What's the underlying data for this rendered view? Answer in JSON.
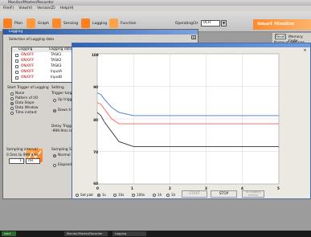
{
  "app": {
    "title": "Monitor/Master/Recorder"
  },
  "menu": [
    "File(F)",
    "View(V)",
    "Version(Z)",
    "Help(H)"
  ],
  "toolbar": {
    "buttons": [
      {
        "label": "Plan",
        "color": "#ff7f1f"
      },
      {
        "label": "Graph",
        "color": "#ff7f1f"
      },
      {
        "label": "Sensing",
        "color": "#ff7f1f"
      },
      {
        "label": "Logging",
        "color": "#ff7f1f"
      },
      {
        "label": "Function",
        "color": "#ff7f1f"
      }
    ],
    "operating_label": "OperatingCH",
    "operating_value": "0CH",
    "brand": "Smart Monitor"
  },
  "logging": {
    "title": "Logging",
    "group_selection": "Selection of Logging data",
    "headers": [
      "Logging",
      "Logging data",
      "Mul",
      "Multipli"
    ],
    "rows": [
      {
        "state": "ON/OFF",
        "data": "TASK1"
      },
      {
        "state": "ON/OFF",
        "data": "TASK2"
      },
      {
        "state": "ON/OFF",
        "data": "TASK3"
      },
      {
        "state": "ON/OFF",
        "data": "InputA"
      },
      {
        "state": "ON/OFF",
        "data": "InputB"
      }
    ],
    "trigger_group": "Start Trigger of Logging",
    "trigger_options": [
      "None",
      "Pattern of I/O",
      "Data Slope",
      "Data Window",
      "Time instant"
    ],
    "trigger_selected": 2,
    "setting_label": "Setting",
    "trigger_target": "Trigger target",
    "up_trigger": "Up trigger",
    "down_trigger": "Down trig",
    "delay_trigger": "Delay Trigger",
    "delay_value": "-999.9ms to 99",
    "sampling_interval": "Sampling interval",
    "sampling_range": "0.5ms to 999.9ms",
    "sampling_value": "1",
    "sampling_unit": "ms",
    "sampling_stop": "Sampling Stop",
    "normal_lo": "Normal lo",
    "elapsed_ti": "Elapsed ti"
  },
  "graph": {
    "y_unit": "mm",
    "y_ticks": [
      "100",
      "90",
      "80",
      "70",
      "60"
    ],
    "x_ticks": [
      "0",
      "1",
      "2",
      "3",
      "4",
      "5"
    ],
    "bottom_options": [
      "Set plot",
      "1s",
      "10s",
      "100s",
      "1h",
      "1h"
    ],
    "bottom_selected": 1,
    "start_label": "START",
    "stop_label": "STOP",
    "save_label": "To Logging Setting"
  },
  "right_panel": {
    "reset_label": "Reset",
    "memory_label": "Memory Code",
    "name_label": "Name of Settings",
    "name_value": "BankGroup1",
    "bank_label": "Bank",
    "bank_index": "1",
    "bank_select": "Bank1",
    "load_label": "Load Setting",
    "save_label": "Save S"
  },
  "chart_data": {
    "type": "line",
    "y_unit": "mm",
    "xlim": [
      0,
      5
    ],
    "ylim": [
      60,
      100
    ],
    "series": [
      {
        "color": "#3d78d8",
        "x": [
          0,
          0.1,
          0.2,
          0.4,
          0.6,
          1.0,
          2.0,
          5.0
        ],
        "y": [
          88,
          87.5,
          86,
          83.5,
          82,
          81,
          81,
          81
        ]
      },
      {
        "color": "#ff5a5a",
        "x": [
          0,
          0.1,
          0.2,
          0.4,
          0.6,
          1.0,
          2.0,
          5.0
        ],
        "y": [
          85,
          84.5,
          83,
          80,
          78.5,
          78.5,
          78.5,
          78.5
        ]
      },
      {
        "color": "#333333",
        "x": [
          0,
          0.1,
          0.2,
          0.4,
          0.6,
          1.0,
          2.0,
          5.0
        ],
        "y": [
          82,
          81,
          79,
          76,
          73,
          71.5,
          71.5,
          71.5
        ]
      }
    ]
  },
  "taskbar": [
    "start",
    "Monitor/Master/Recorder",
    "Logging"
  ]
}
